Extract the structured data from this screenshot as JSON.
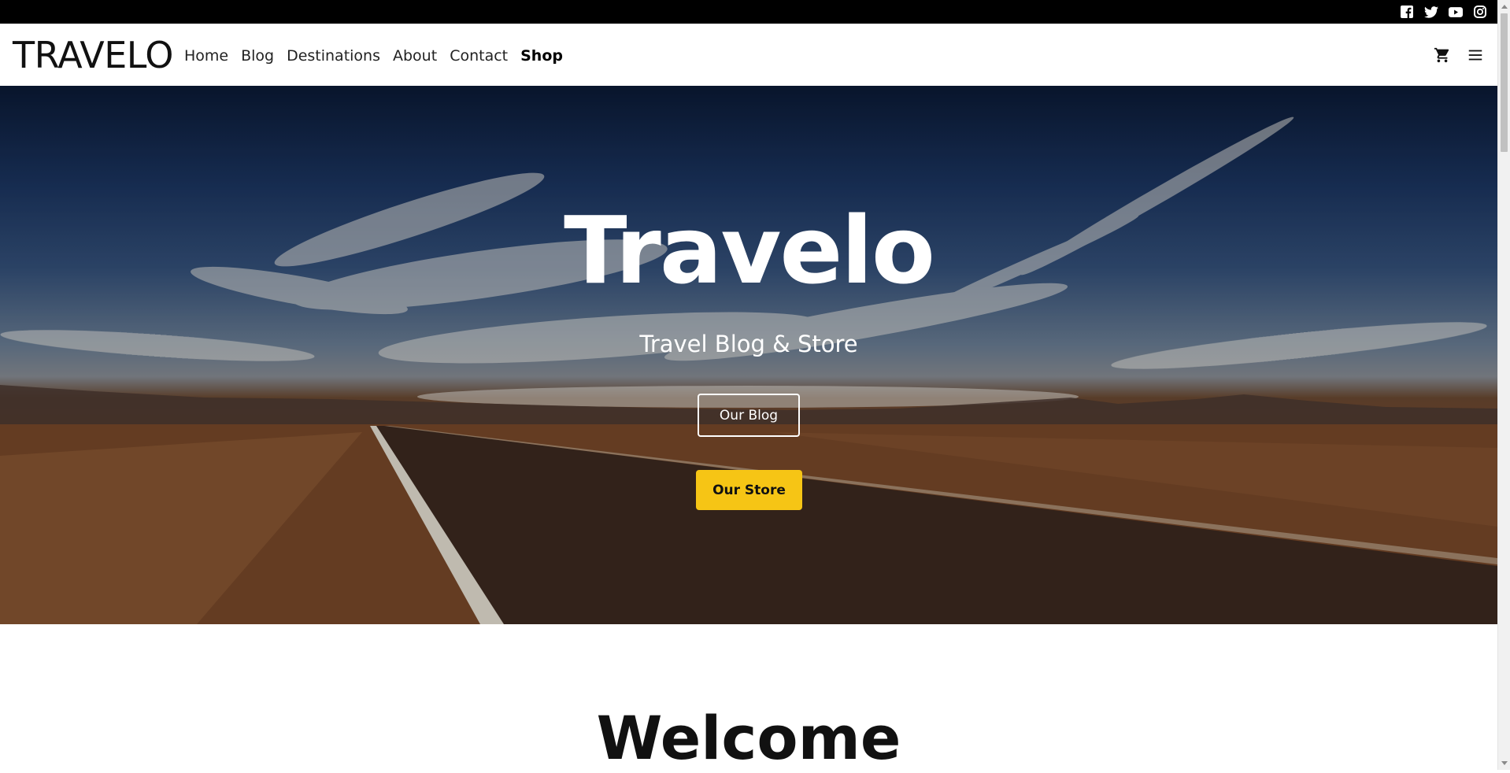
{
  "topbar": {
    "icons": [
      "facebook-icon",
      "twitter-icon",
      "youtube-icon",
      "instagram-icon"
    ]
  },
  "header": {
    "logo": "TRAVELO",
    "nav": [
      {
        "label": "Home",
        "active": false
      },
      {
        "label": "Blog",
        "active": false
      },
      {
        "label": "Destinations",
        "active": false
      },
      {
        "label": "About",
        "active": false
      },
      {
        "label": "Contact",
        "active": false
      },
      {
        "label": "Shop",
        "active": true
      }
    ],
    "right_icons": [
      "cart-icon",
      "menu-icon"
    ]
  },
  "hero": {
    "title": "Travelo",
    "subtitle": "Travel Blog & Store",
    "blog_button": "Our Blog",
    "store_button": "Our Store"
  },
  "welcome": {
    "heading": "Welcome"
  },
  "colors": {
    "accent": "#f6c515",
    "topbar": "#000000",
    "text_dark": "#111111",
    "white": "#ffffff"
  }
}
